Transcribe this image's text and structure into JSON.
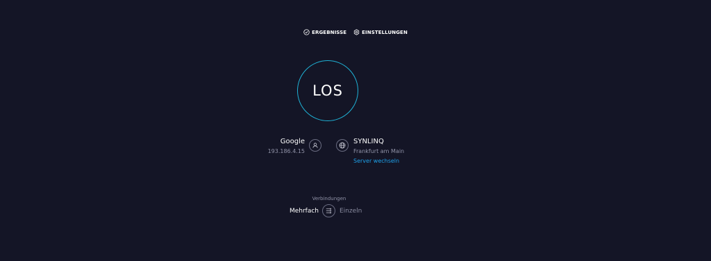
{
  "nav": {
    "results": {
      "label": "ERGEBNISSE",
      "icon": "check-circle-icon"
    },
    "settings": {
      "label": "EINSTELLUNGEN",
      "icon": "gear-icon"
    }
  },
  "go_button": {
    "label": "LOS"
  },
  "isp": {
    "name": "Google",
    "ip": "193.186.4.15",
    "icon": "user-icon"
  },
  "server": {
    "name": "SYNLINQ",
    "location": "Frankfurt am Main",
    "change_link": "Server wechseln",
    "icon": "globe-icon"
  },
  "connections": {
    "title": "Verbindungen",
    "multi_label": "Mehrfach",
    "single_label": "Einzeln",
    "selected": "Mehrfach"
  },
  "colors": {
    "background": "#141526",
    "accent_ring": "#1fb2d6",
    "link": "#1ea0e8",
    "muted_text": "#9193a8"
  }
}
